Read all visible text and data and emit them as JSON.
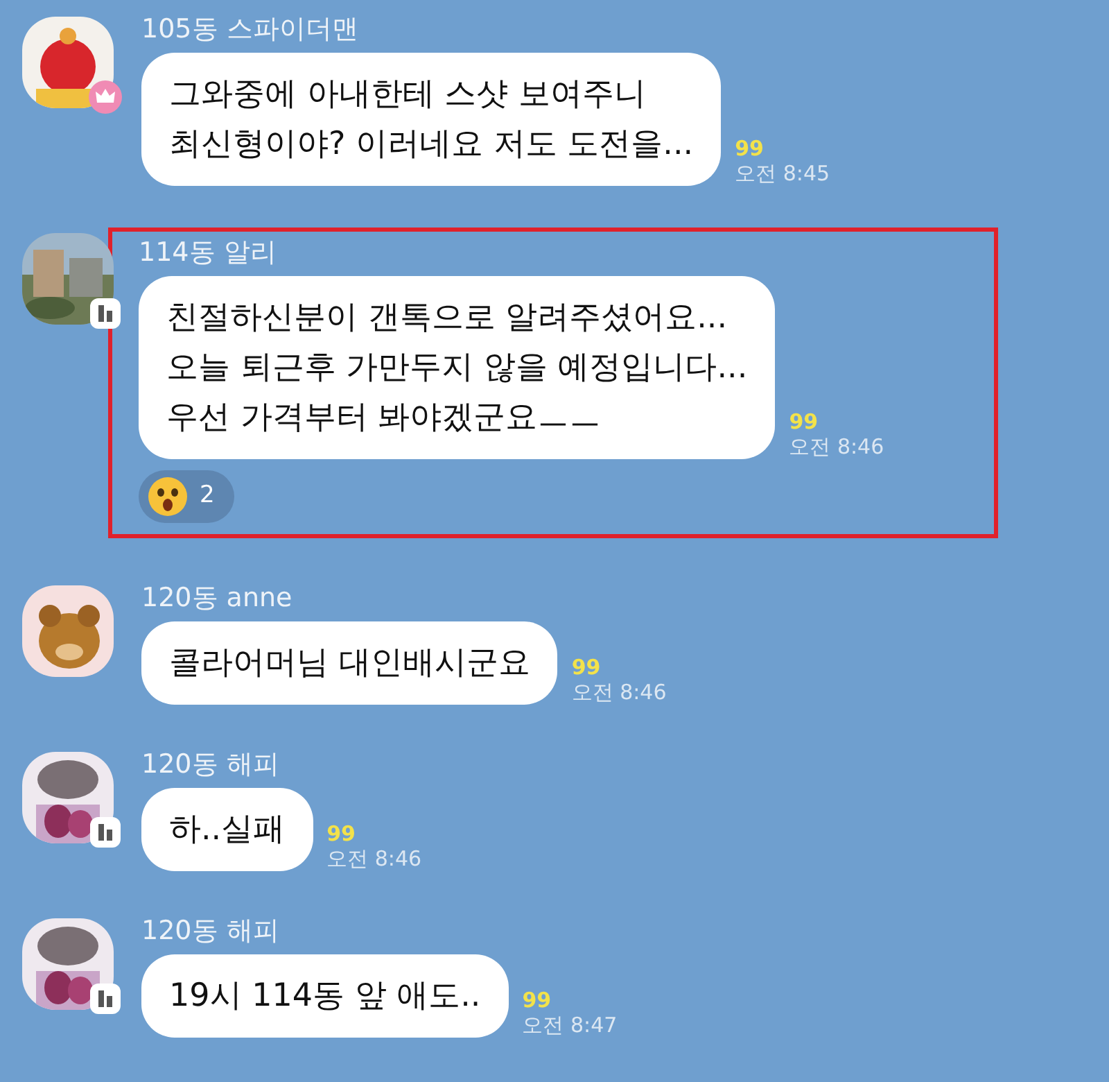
{
  "messages": [
    {
      "sender": "105동 스파이더맨",
      "kind": "crown",
      "text": "그와중에 아내한테 스샷 보여주니\n최신형이야? 이러네요 저도 도전을...",
      "unread": "99",
      "time": "오전 8:45",
      "highlighted": false
    },
    {
      "sender": "114동 알리",
      "kind": "building",
      "text": "친절하신분이 갠톡으로 알려주셨어요...\n오늘 퇴근후 가만두지 않을 예정입니다...\n우선 가격부터 봐야겠군요ㅡㅡ",
      "unread": "99",
      "time": "오전 8:46",
      "highlighted": true,
      "reactions": [
        {
          "count": "2"
        }
      ]
    },
    {
      "sender": "120동 anne",
      "kind": "plain",
      "text": "콜라어머님 대인배시군요",
      "unread": "99",
      "time": "오전 8:46",
      "highlighted": false
    },
    {
      "sender": "120동 해피",
      "kind": "building",
      "text": "하..실패",
      "unread": "99",
      "time": "오전 8:46",
      "highlighted": false
    },
    {
      "sender": "120동 해피",
      "kind": "building",
      "text": "19시 114동 앞 애도..",
      "unread": "99",
      "time": "오전 8:47",
      "highlighted": false
    }
  ]
}
